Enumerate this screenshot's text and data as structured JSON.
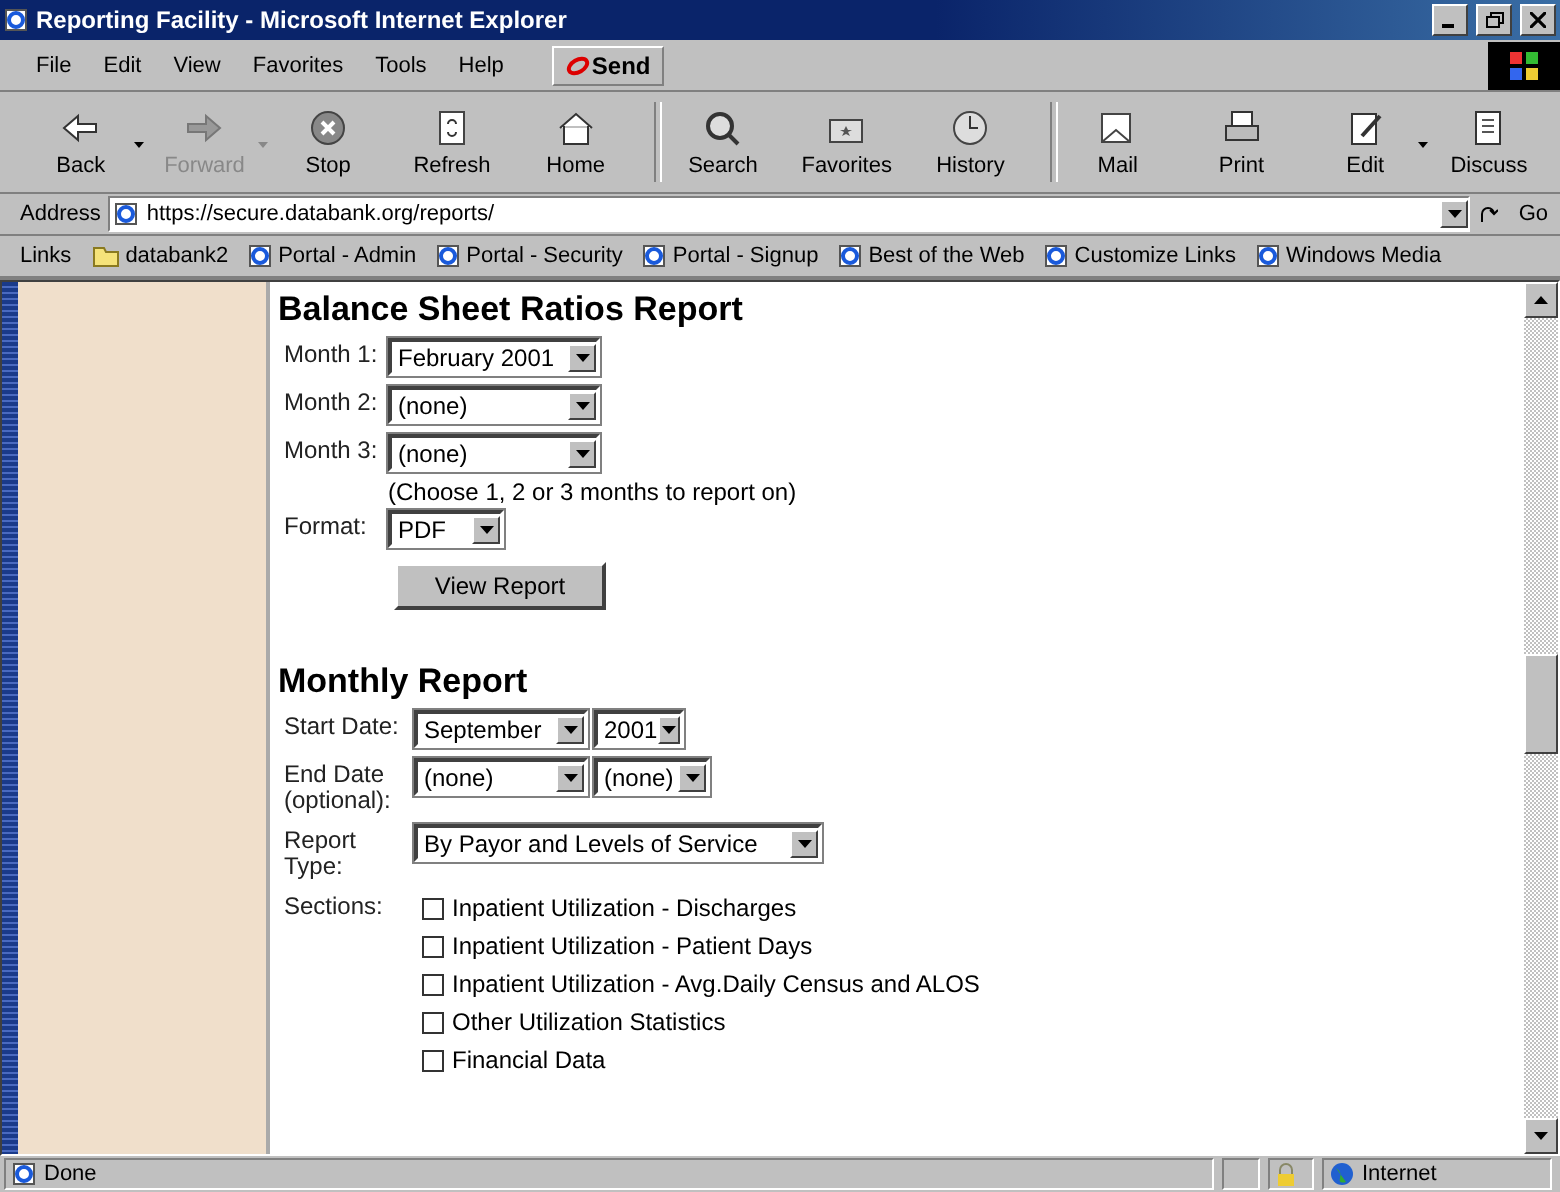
{
  "window": {
    "title": "Reporting Facility - Microsoft Internet Explorer"
  },
  "menu": [
    "File",
    "Edit",
    "View",
    "Favorites",
    "Tools",
    "Help"
  ],
  "send_button": "Send",
  "toolbar": [
    {
      "label": "Back",
      "kind": "back",
      "disabled": false,
      "dropdown": true
    },
    {
      "label": "Forward",
      "kind": "forward",
      "disabled": true,
      "dropdown": true
    },
    {
      "label": "Stop",
      "kind": "stop",
      "disabled": false,
      "dropdown": false
    },
    {
      "label": "Refresh",
      "kind": "refresh",
      "disabled": false,
      "dropdown": false
    },
    {
      "label": "Home",
      "kind": "home",
      "disabled": false,
      "dropdown": false
    },
    {
      "label": "Search",
      "kind": "search",
      "disabled": false,
      "dropdown": false
    },
    {
      "label": "Favorites",
      "kind": "favorites",
      "disabled": false,
      "dropdown": false
    },
    {
      "label": "History",
      "kind": "history",
      "disabled": false,
      "dropdown": false
    },
    {
      "label": "Mail",
      "kind": "mail",
      "disabled": false,
      "dropdown": false
    },
    {
      "label": "Print",
      "kind": "print",
      "disabled": false,
      "dropdown": false
    },
    {
      "label": "Edit",
      "kind": "edit",
      "disabled": false,
      "dropdown": true
    },
    {
      "label": "Discuss",
      "kind": "discuss",
      "disabled": false,
      "dropdown": false
    }
  ],
  "address": {
    "label": "Address",
    "value": "https://secure.databank.org/reports/",
    "go": "Go"
  },
  "links": {
    "label": "Links",
    "items": [
      {
        "label": "databank2",
        "kind": "folder"
      },
      {
        "label": "Portal - Admin",
        "kind": "page"
      },
      {
        "label": "Portal - Security",
        "kind": "page"
      },
      {
        "label": "Portal - Signup",
        "kind": "page"
      },
      {
        "label": "Best of the Web",
        "kind": "page"
      },
      {
        "label": "Customize Links",
        "kind": "page"
      },
      {
        "label": "Windows Media",
        "kind": "page"
      }
    ]
  },
  "balance_report": {
    "title": "Balance Sheet Ratios Report",
    "fields": [
      {
        "label": "Month 1:",
        "value": "February 2001"
      },
      {
        "label": "Month 2:",
        "value": "(none)"
      },
      {
        "label": "Month 3:",
        "value": "(none)"
      }
    ],
    "hint": "(Choose 1, 2 or 3 months to report on)",
    "format": {
      "label": "Format:",
      "value": "PDF"
    },
    "button": "View Report"
  },
  "monthly_report": {
    "title": "Monthly Report",
    "start_date": {
      "label": "Start Date:",
      "month": "September",
      "year": "2001"
    },
    "end_date": {
      "label": "End Date (optional):",
      "month": "(none)",
      "year": "(none)"
    },
    "report_type": {
      "label": "Report Type:",
      "value": "By Payor and Levels of Service"
    },
    "sections_label": "Sections:",
    "sections": [
      {
        "label": "Inpatient Utilization - Discharges",
        "checked": false
      },
      {
        "label": "Inpatient Utilization - Patient Days",
        "checked": false
      },
      {
        "label": "Inpatient Utilization - Avg.Daily Census and ALOS",
        "checked": false
      },
      {
        "label": "Other Utilization Statistics",
        "checked": false
      },
      {
        "label": "Financial Data",
        "checked": false
      }
    ]
  },
  "status_bar": {
    "text": "Done",
    "zone": "Internet"
  }
}
